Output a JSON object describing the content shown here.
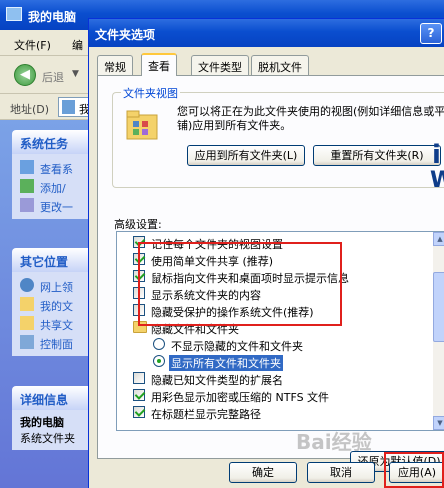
{
  "explorer": {
    "title": "我的电脑",
    "menu": [
      "文件(F)",
      "编"
    ],
    "back_label": "后退",
    "address_label": "地址(D)",
    "address_value": "我",
    "tasks_panel": {
      "title": "系统任务",
      "items": [
        "查看系",
        "添加/",
        "更改一"
      ]
    },
    "places_panel": {
      "title": "其它位置",
      "items": [
        "网上领",
        "我的文",
        "共享文",
        "控制面"
      ]
    },
    "details_panel": {
      "title": "详细信息",
      "name": "我的电脑",
      "desc": "系统文件夹"
    }
  },
  "dialog": {
    "title": "文件夹选项",
    "help": "?",
    "tabs": [
      "常规",
      "查看",
      "文件类型",
      "脱机文件"
    ],
    "active_tab": "查看",
    "folder_views": {
      "legend": "文件夹视图",
      "description": "您可以将正在为此文件夹使用的视图(例如详细信息或平铺)应用到所有文件夹。",
      "apply_all_label": "应用到所有文件夹(L)",
      "reset_all_label": "重置所有文件夹(R)"
    },
    "advanced_label": "高级设置:",
    "items": [
      {
        "kind": "checkbox",
        "checked": true,
        "label": "记住每个文件夹的视图设置"
      },
      {
        "kind": "checkbox",
        "checked": true,
        "label": "使用简单文件共享 (推荐)"
      },
      {
        "kind": "checkbox",
        "checked": true,
        "label": "鼠标指向文件夹和桌面项时显示提示信息"
      },
      {
        "kind": "checkbox",
        "checked": false,
        "label": "显示系统文件夹的内容"
      },
      {
        "kind": "checkbox",
        "checked": false,
        "label": "隐藏受保护的操作系统文件(推荐)"
      },
      {
        "kind": "folder",
        "label": "隐藏文件和文件夹"
      },
      {
        "kind": "radio",
        "checked": false,
        "label": "不显示隐藏的文件和文件夹"
      },
      {
        "kind": "radio",
        "checked": true,
        "label": "显示所有文件和文件夹"
      },
      {
        "kind": "checkbox",
        "checked": false,
        "label": "隐藏已知文件类型的扩展名"
      },
      {
        "kind": "checkbox",
        "checked": true,
        "label": "用彩色显示加密或压缩的 NTFS 文件"
      },
      {
        "kind": "checkbox",
        "checked": true,
        "label": "在标题栏显示完整路径"
      }
    ],
    "restore_label": "还原为默认值(D)",
    "ok_label": "确定",
    "cancel_label": "取消",
    "apply_label": "应用(A)"
  },
  "watermark": "Bai经验",
  "side_letters": [
    "i",
    "W"
  ]
}
